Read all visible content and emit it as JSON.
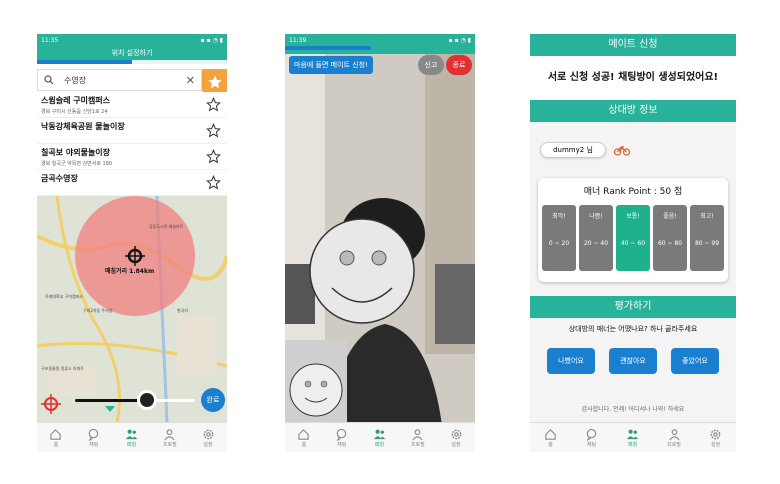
{
  "phone1": {
    "status_time": "11:35",
    "title": "위치 설정하기",
    "search": {
      "value": "수영장"
    },
    "results": [
      {
        "name": "스윔슬레 구미캠퍼스",
        "addr": "경북 구미시 산동읍 신당1로 24"
      },
      {
        "name": "낙동강체육공원 물놀이장",
        "addr": ""
      },
      {
        "name": "칠곡보 야외물놀이장",
        "addr": "경북 칠곡군 약목면 강변서로 180"
      },
      {
        "name": "금곡수영장",
        "addr": ""
      }
    ],
    "map": {
      "distance_label": "매칭거리 1.84km",
      "place_labels": [
        "공동도시락 예슬마트",
        "농동",
        "옥계대학교 구미캠퍼스",
        "구미2차동 주자방",
        "구포동물원 정류소 아파트",
        "봉곡리"
      ]
    },
    "done_label": "완료",
    "nav": [
      "홈",
      "채팅",
      "매칭",
      "프로필",
      "설정"
    ]
  },
  "phone2": {
    "status_time": "11:39",
    "mate_button": "마음에 들면 메이트 신청!",
    "report_button": "신고",
    "end_button": "종료",
    "nav": [
      "홈",
      "채팅",
      "매칭",
      "프로필",
      "설정"
    ]
  },
  "phone3": {
    "mate_request_header": "메이트 신청",
    "success_message": "서로 신청 성공! 채팅방이 생성되었어요!",
    "opponent_header": "상대방 정보",
    "opponent_name": "dummy2 님",
    "rank_title": "매너 Rank Point : 50 점",
    "rank_point": 50,
    "ranks": [
      {
        "label": "최악!",
        "range": "0 ~ 20"
      },
      {
        "label": "나쁨!",
        "range": "20 ~ 40"
      },
      {
        "label": "보통!",
        "range": "40 ~ 60"
      },
      {
        "label": "좋음!",
        "range": "60 ~ 80"
      },
      {
        "label": "최고!",
        "range": "80 ~ 99"
      }
    ],
    "selected_rank": 2,
    "evaluate_header": "평가하기",
    "evaluate_question": "상대방의 매너는 어땠나요? 하나 골라주세요",
    "evaluate_options": [
      "나빴어요",
      "괜찮아요",
      "좋았어요"
    ],
    "thanks_message": "감사합니다. 언제! 어디서나 나와! 하세요",
    "nav": [
      "홈",
      "채팅",
      "매칭",
      "프로필",
      "설정"
    ]
  },
  "colors": {
    "teal": "#29b29a",
    "blue": "#1b7fd0",
    "orange": "#f4a23c",
    "red": "#e23030"
  }
}
